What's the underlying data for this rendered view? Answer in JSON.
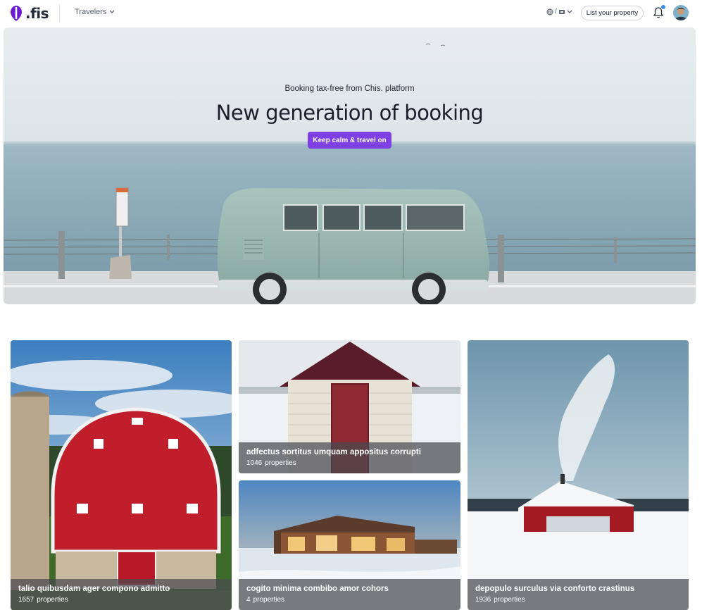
{
  "header": {
    "logo_text": ".fis",
    "travelers_label": "Travelers",
    "lang_separator": "/",
    "list_property_label": "List your property"
  },
  "hero": {
    "subtitle": "Booking tax-free from Chis. platform",
    "title": "New generation of booking",
    "cta_label": "Keep calm & travel on"
  },
  "cards": [
    {
      "title": "talio quibusdam ager compono admitto",
      "count": "1657",
      "unit": "properties"
    },
    {
      "title": "adfectus sortitus umquam appositus corrupti",
      "count": "1046",
      "unit": "properties"
    },
    {
      "title": "cogito minima combibo amor cohors",
      "count": "4",
      "unit": "properties"
    },
    {
      "title": "depopulo surculus via conforto crastinus",
      "count": "1936",
      "unit": "properties"
    }
  ],
  "colors": {
    "brand": "#7e3fe4",
    "logo": "#6a1bd0",
    "notification_dot": "#3b8ff0"
  },
  "icons": [
    "logo-icon",
    "chevron-down-icon",
    "globe-icon",
    "currency-icon",
    "bell-icon",
    "avatar"
  ]
}
